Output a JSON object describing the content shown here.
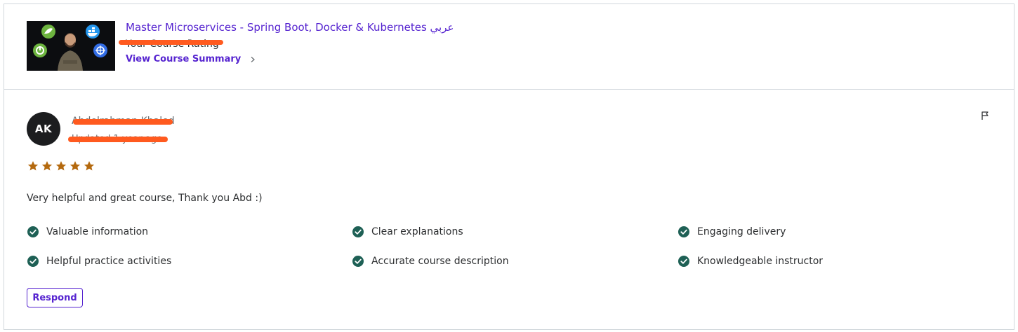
{
  "course": {
    "title": "Master Microservices - Spring Boot, Docker & Kubernetes عربي",
    "rating_label": "Your Course Rating",
    "summary_link": "View Course Summary",
    "thumbnail_icons": [
      "spring-icon",
      "docker-icon",
      "spring-boot-icon",
      "kubernetes-icon"
    ]
  },
  "review": {
    "avatar_initials": "AK",
    "reviewer_name": "Abdelrahman Khaled",
    "date": "Updated 1 year ago",
    "rating": 5,
    "max_rating": 5,
    "text": "Very helpful and great course, Thank you Abd :)",
    "tags": [
      "Valuable information",
      "Clear explanations",
      "Engaging delivery",
      "Helpful practice activities",
      "Accurate course description",
      "Knowledgeable instructor"
    ],
    "respond_label": "Respond"
  },
  "colors": {
    "accent": "#5624d0",
    "star": "#b4690e",
    "check": "#1e6055",
    "redaction": "#ff5a1f"
  }
}
